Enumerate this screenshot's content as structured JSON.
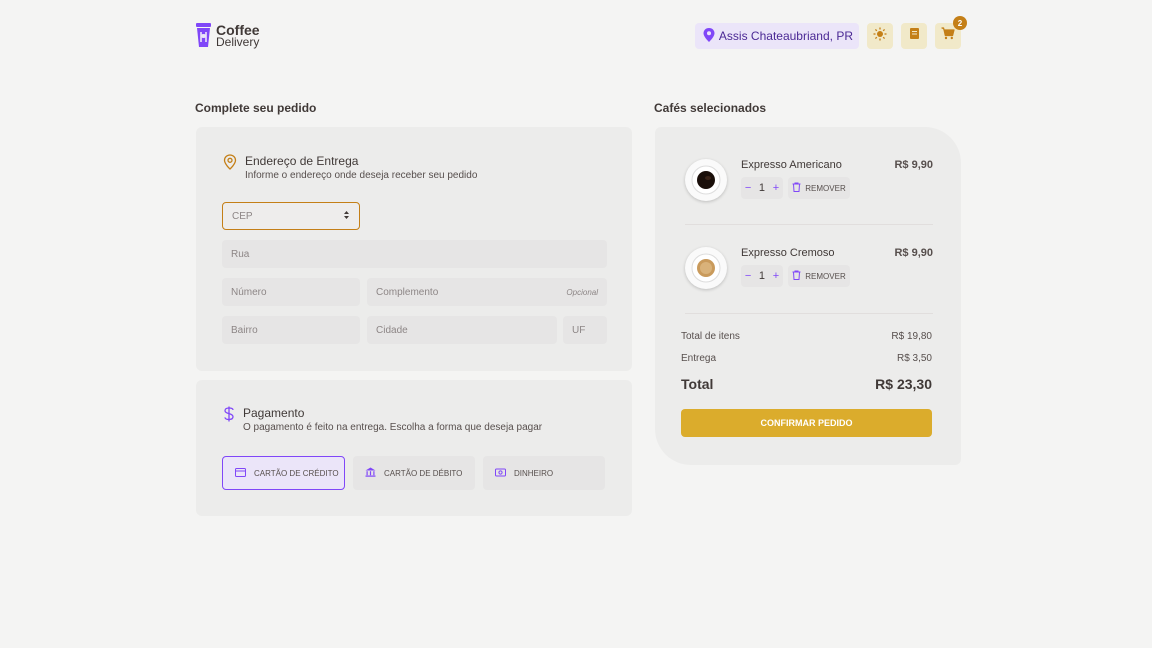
{
  "brand": {
    "line1": "Coffee",
    "line2": "Delivery"
  },
  "header": {
    "location": "Assis Chateaubriand, PR",
    "cart_count": "2"
  },
  "checkout": {
    "title": "Complete seu pedido",
    "address": {
      "heading": "Endereço de Entrega",
      "subheading": "Informe o endereço onde deseja receber seu pedido",
      "cep_placeholder": "CEP",
      "rua_placeholder": "Rua",
      "numero_placeholder": "Número",
      "complemento_placeholder": "Complemento",
      "complemento_optional": "Opcional",
      "bairro_placeholder": "Bairro",
      "cidade_placeholder": "Cidade",
      "uf_placeholder": "UF"
    },
    "payment": {
      "heading": "Pagamento",
      "subheading": "O pagamento é feito na entrega. Escolha a forma que deseja pagar",
      "options": [
        "Cartão de crédito",
        "Cartão de débito",
        "Dinheiro"
      ],
      "selected": "Cartão de crédito"
    }
  },
  "order": {
    "title": "Cafés selecionados",
    "items": [
      {
        "name": "Expresso Americano",
        "price": "R$ 9,90",
        "quantity": "1"
      },
      {
        "name": "Expresso Cremoso",
        "price": "R$ 9,90",
        "quantity": "1"
      }
    ],
    "remove_label": "REMOVER",
    "minus": "−",
    "plus": "+",
    "summary": {
      "items_label": "Total de itens",
      "items_value": "R$ 19,80",
      "delivery_label": "Entrega",
      "delivery_value": "R$ 3,50",
      "total_label": "Total",
      "total_value": "R$ 23,30"
    },
    "confirm_label": "Confirmar pedido"
  },
  "colors": {
    "yellow": "#dbac2c",
    "yellow_dark": "#c47f17",
    "purple": "#8047f8",
    "purple_dark": "#4b2995",
    "purple_light": "#ebe5f9"
  },
  "icons": [
    "logo-cup-icon",
    "map-pin-icon",
    "sun-icon",
    "scroll-icon",
    "cart-icon",
    "location-icon",
    "dollar-icon",
    "credit-card-icon",
    "bank-icon",
    "money-icon",
    "trash-icon"
  ]
}
